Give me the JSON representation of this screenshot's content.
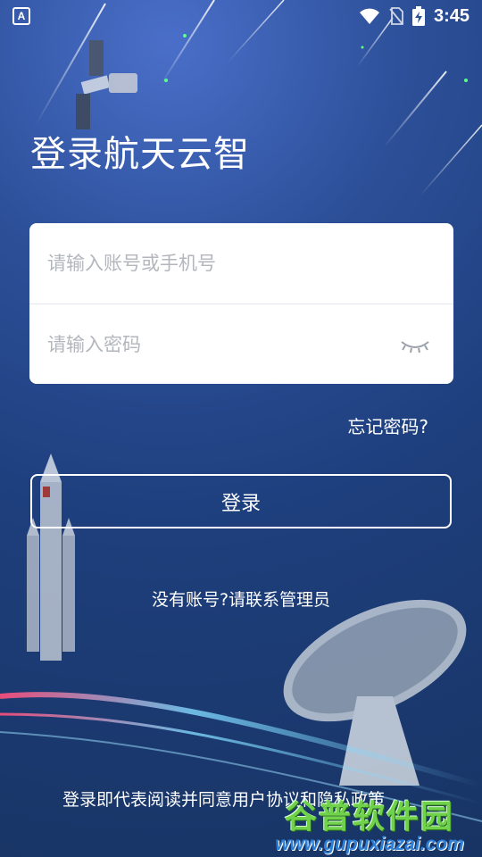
{
  "status_bar": {
    "time": "3:45",
    "app_icon_letter": "A"
  },
  "title": "登录航天云智",
  "form": {
    "account_placeholder": "请输入账号或手机号",
    "password_placeholder": "请输入密码"
  },
  "forgot_password": "忘记密码?",
  "login_button": "登录",
  "no_account": "没有账号?请联系管理员",
  "agreement_text": "登录即代表阅读并同意用户协议和隐私政策",
  "watermark": {
    "name": "谷普软件园",
    "url": "www.gupuxiazai.com"
  },
  "colors": {
    "bg_top": "#4a6fc9",
    "bg_bottom": "#183464",
    "watermark_green": "#6fd24a",
    "watermark_blue": "#2e7fd6"
  }
}
